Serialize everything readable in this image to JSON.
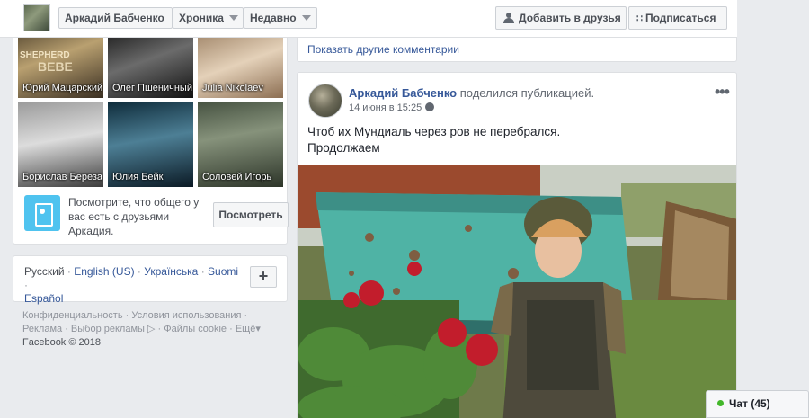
{
  "topbar": {
    "profile_name": "Аркадий Бабченко",
    "chronicle_label": "Хроника",
    "recent_label": "Недавно",
    "add_friend_label": "Добавить в друзья",
    "subscribe_label": "Подписаться"
  },
  "friends": {
    "items": [
      {
        "name": "Юрий Мацарский"
      },
      {
        "name": "Олег Пшеничный"
      },
      {
        "name": "Julia Nikolaev"
      },
      {
        "name": "Борислав Береза"
      },
      {
        "name": "Юлия Бейк"
      },
      {
        "name": "Соловей Игорь"
      }
    ],
    "shepherd_text": "SHEPHERD",
    "bebe_text": "BEBE",
    "mutual_text": "Посмотрите, что общего у вас есть с друзьями Аркадия.",
    "mutual_button": "Посмотреть"
  },
  "languages": {
    "current": "Русский",
    "options": [
      "English (US)",
      "Українська",
      "Suomi",
      "Español"
    ],
    "sep": "·",
    "plus": "+"
  },
  "footer": {
    "links": [
      "Конфиденциальность",
      "Условия использования",
      "Реклама",
      "Выбор рекламы",
      "Файлы cookie",
      "Ещё"
    ],
    "copyright": "Facebook © 2018"
  },
  "comments": {
    "more_label": "Показать другие комментарии"
  },
  "post": {
    "author": "Аркадий Бабченко",
    "action": "поделился публикацией.",
    "date": "14 июня в 15:25",
    "more": "•••",
    "text_line1": "Чтоб их Мундиаль через ров не перебрался.",
    "text_line2": "Продолжаем"
  },
  "chat": {
    "label": "Чат (45)"
  },
  "colors": {
    "link": "#365899",
    "accent_online": "#42b72a",
    "page_bg": "#e9ebee"
  }
}
